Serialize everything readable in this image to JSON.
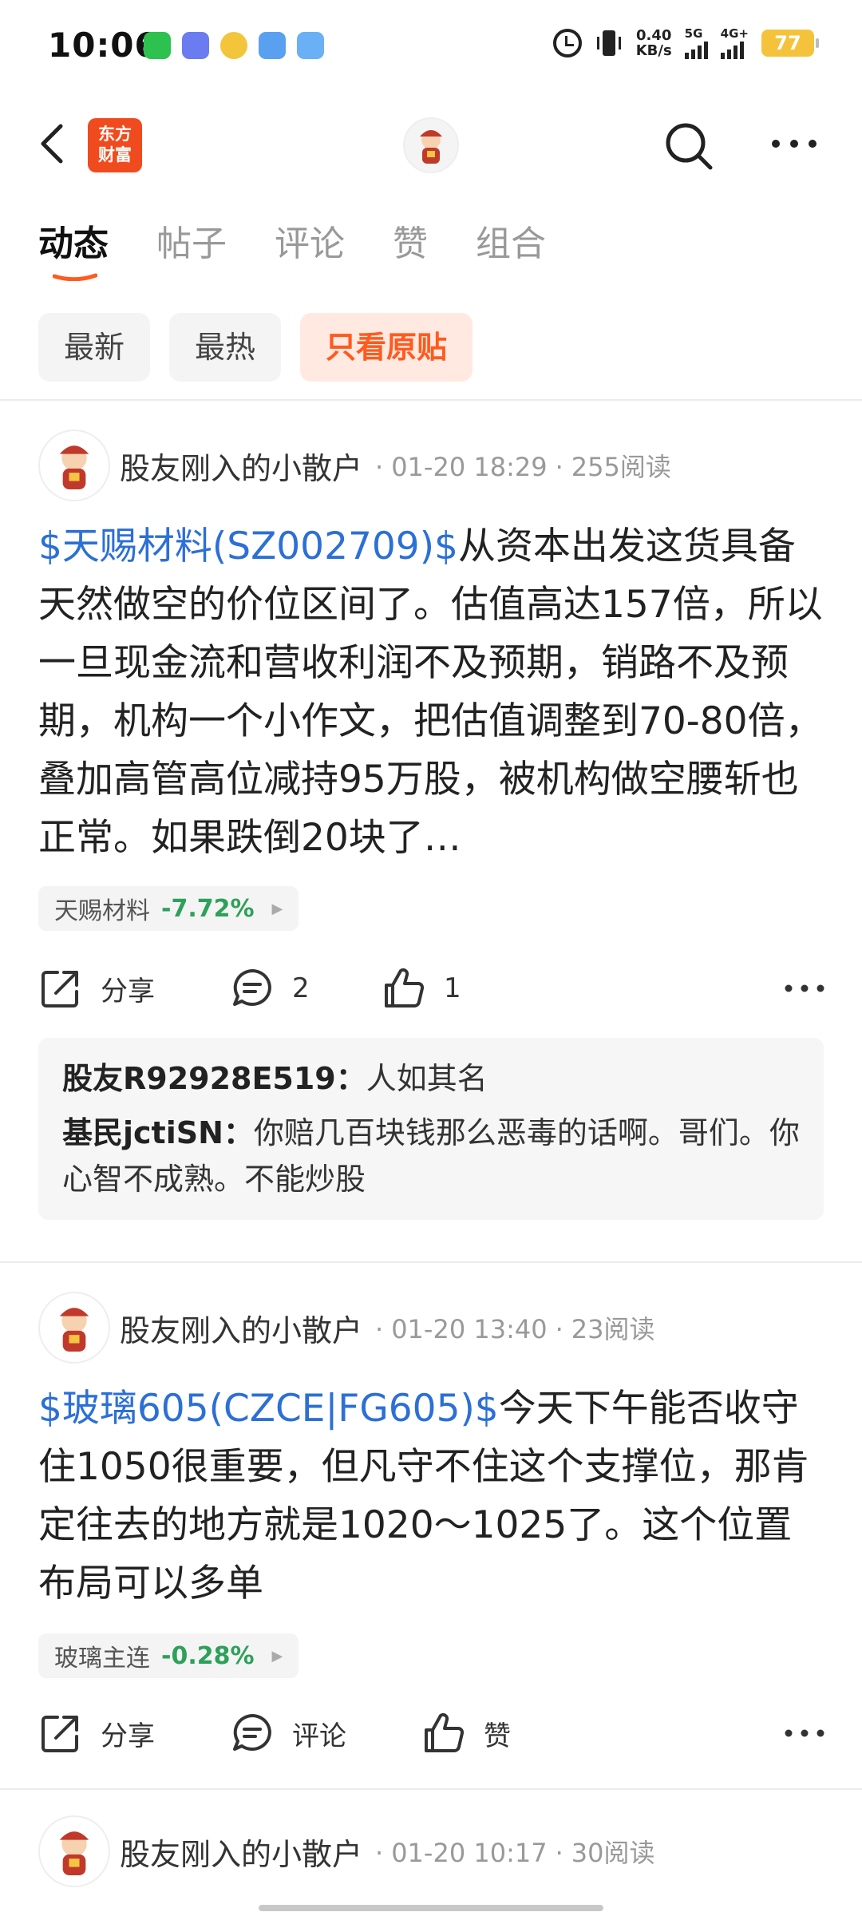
{
  "status_bar": {
    "time": "10:06",
    "net_speed_value": "0.40",
    "net_speed_unit": "KB/s",
    "network_1": "5G",
    "network_2": "4G+",
    "battery": "77"
  },
  "nav": {
    "logo_text_1": "东方",
    "logo_text_2": "财富"
  },
  "tabs": [
    {
      "label": "动态",
      "active": true
    },
    {
      "label": "帖子",
      "active": false
    },
    {
      "label": "评论",
      "active": false
    },
    {
      "label": "赞",
      "active": false
    },
    {
      "label": "组合",
      "active": false
    }
  ],
  "filters": [
    {
      "label": "最新",
      "active": false
    },
    {
      "label": "最热",
      "active": false
    },
    {
      "label": "只看原贴",
      "active": true
    }
  ],
  "posts": [
    {
      "author": "股友刚入的小散户",
      "time": "01-20 18:29",
      "reads": "255阅读",
      "stock": "$天赐材料(SZ002709)$",
      "text": "从资本出发这货具备天然做空的价位区间了。估值高达157倍，所以一旦现金流和营收利润不及预期，销路不及预期，机构一个小作文，把估值调整到70-80倍，叠加高管高位减持95万股，被机构做空腰斩也正常。如果跌倒20块了…",
      "tag_name": "天赐材料",
      "tag_change": "-7.72%",
      "share_label": "分享",
      "comment_label": "2",
      "like_label": "1",
      "comments": [
        {
          "user": "股友R92928E519：",
          "text": "人如其名"
        },
        {
          "user": "基民jctiSN：",
          "text": "你赔几百块钱那么恶毒的话啊。哥们。你心智不成熟。不能炒股"
        }
      ]
    },
    {
      "author": "股友刚入的小散户",
      "time": "01-20 13:40",
      "reads": "23阅读",
      "stock": "$玻璃605(CZCE|FG605)$",
      "text": "今天下午能否收守住1050很重要，但凡守不住这个支撑位，那肯定往去的地方就是1020～1025了。这个位置布局可以多单",
      "tag_name": "玻璃主连",
      "tag_change": "-0.28%",
      "share_label": "分享",
      "comment_label": "评论",
      "like_label": "赞"
    },
    {
      "author": "股友刚入的小散户",
      "time": "01-20 10:17",
      "reads": "30阅读"
    }
  ],
  "colors": {
    "accent": "#ff5a1f",
    "stock_link": "#2c6fd6",
    "down_change": "#2da15a"
  }
}
